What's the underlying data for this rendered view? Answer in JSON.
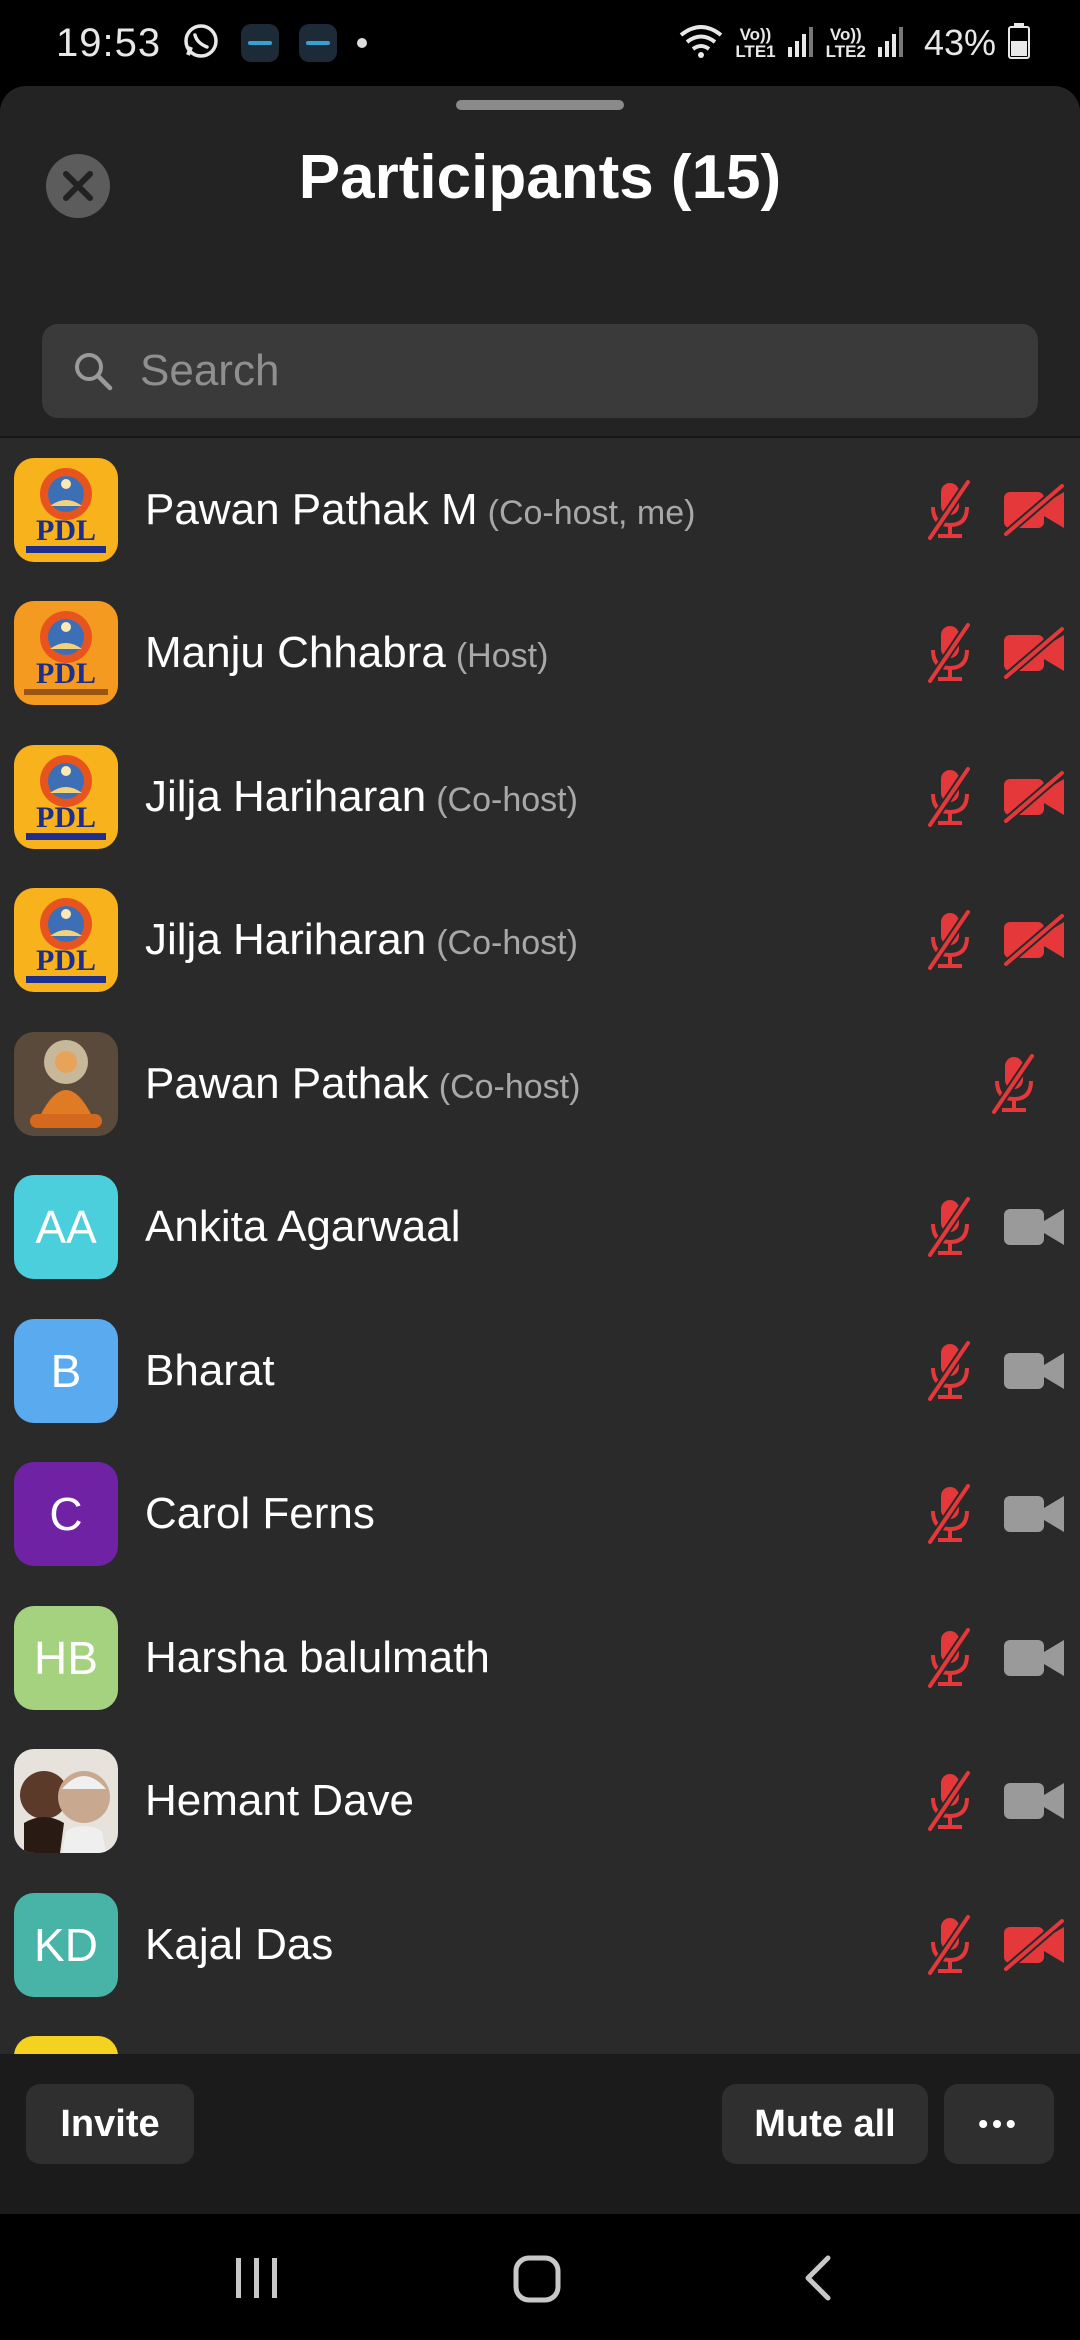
{
  "status_bar": {
    "time": "19:53",
    "lte1": "Vo))\nLTE1",
    "lte1_top": "Vo))",
    "lte1_bottom": "LTE1",
    "lte2_top": "Vo))",
    "lte2_bottom": "LTE2",
    "battery": "43%"
  },
  "header": {
    "title": "Participants (15)"
  },
  "search": {
    "placeholder": "Search"
  },
  "participants": [
    {
      "name": "Pawan Pathak M",
      "role": "(Co-host, me)",
      "avatar": "pdl-logo",
      "mic": "muted",
      "video": "off"
    },
    {
      "name": "Manju Chhabra",
      "role": "(Host)",
      "avatar": "pdl-foundation-logo",
      "mic": "muted",
      "video": "off"
    },
    {
      "name": "Jilja Hariharan",
      "role": "(Co-host)",
      "avatar": "pdl-logo",
      "mic": "muted",
      "video": "off"
    },
    {
      "name": "Jilja Hariharan",
      "role": "(Co-host)",
      "avatar": "pdl-logo",
      "mic": "muted",
      "video": "off"
    },
    {
      "name": "Pawan Pathak",
      "role": "(Co-host)",
      "avatar": "buddha-photo",
      "mic": "muted",
      "video": "none"
    },
    {
      "name": "Ankita Agarwaal",
      "role": "",
      "initials": "AA",
      "mic": "muted",
      "video": "on"
    },
    {
      "name": "Bharat",
      "role": "",
      "initials": "B",
      "mic": "muted",
      "video": "on"
    },
    {
      "name": "Carol Ferns",
      "role": "",
      "initials": "C",
      "mic": "muted",
      "video": "on"
    },
    {
      "name": "Harsha balulmath",
      "role": "",
      "initials": "HB",
      "mic": "muted",
      "video": "on"
    },
    {
      "name": "Hemant Dave",
      "role": "",
      "avatar": "photo",
      "mic": "muted",
      "video": "on"
    },
    {
      "name": "Kajal Das",
      "role": "",
      "initials": "KD",
      "mic": "muted",
      "video": "off"
    }
  ],
  "pdl_logo_text": "PDL",
  "footer": {
    "invite_label": "Invite",
    "mute_all_label": "Mute all",
    "more_label": "•••"
  },
  "colors": {
    "muted_red": "#e5383b",
    "video_gray": "#9a9a9a",
    "avatar_aa": "#4ccfdc",
    "avatar_b": "#5aaaf0",
    "avatar_c": "#6f22a4",
    "avatar_hb": "#a5d27f",
    "avatar_kd": "#47b4a7",
    "avatar_next": "#f5d21f"
  }
}
